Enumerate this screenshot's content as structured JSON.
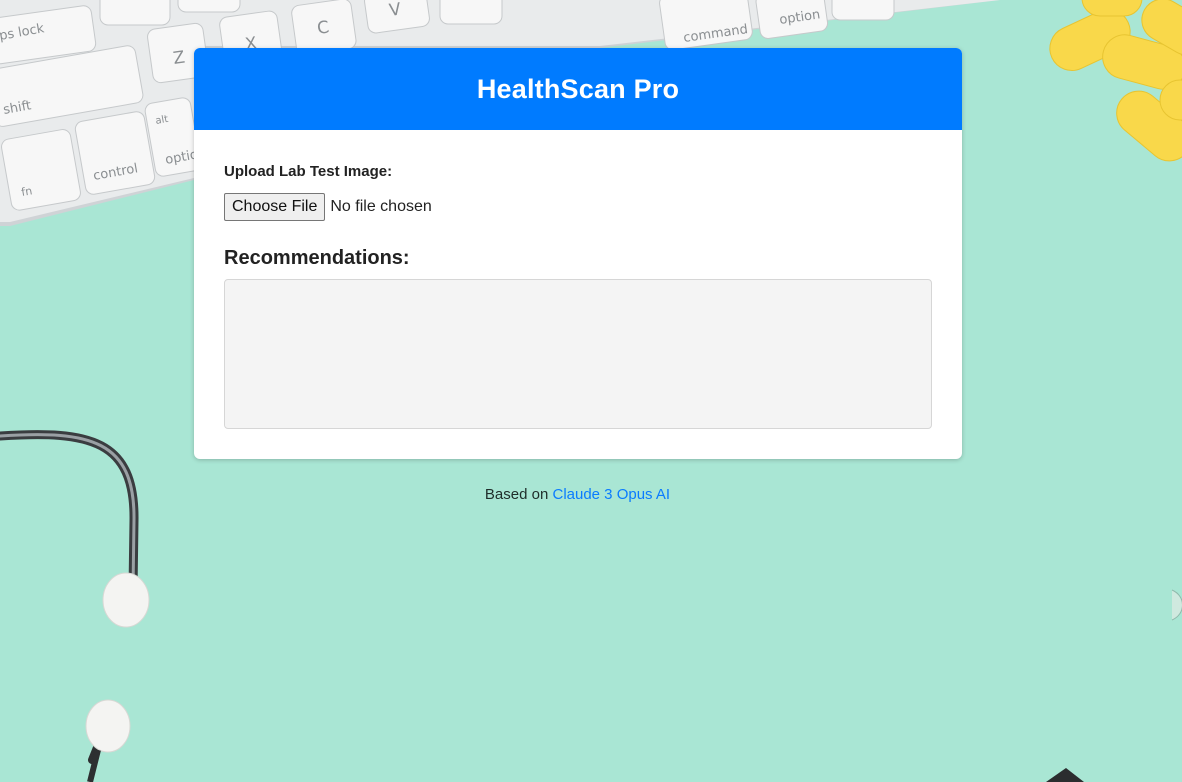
{
  "app": {
    "title": "HealthScan Pro"
  },
  "upload": {
    "label": "Upload Lab Test Image:",
    "button_label": "Choose File",
    "status_text": "No file chosen"
  },
  "recommendations": {
    "heading": "Recommendations:",
    "content": ""
  },
  "footer": {
    "prefix": "Based on",
    "link_text": "Claude 3 Opus AI"
  },
  "colors": {
    "header_bg": "#007bff",
    "page_bg": "#a9e6d4",
    "link": "#0a7bff",
    "pills": "#f9d84a"
  },
  "background_objects": [
    "keyboard",
    "stethoscope",
    "pills"
  ],
  "keyboard_keys": [
    "ps lock",
    "shift",
    "fn",
    "control",
    "alt",
    "option",
    "Z",
    "X",
    "C",
    "V",
    "command",
    "option"
  ]
}
